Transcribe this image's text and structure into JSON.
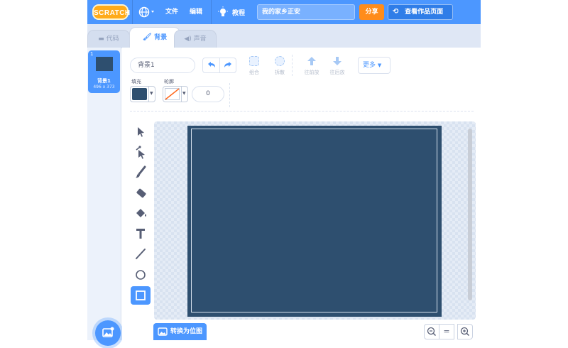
{
  "menubar": {
    "logo": "SCRATCH",
    "file": "文件",
    "edit": "编辑",
    "tutorials": "教程",
    "project_title": "我的家乡正安",
    "share": "分享",
    "see_project": "查看作品页面"
  },
  "tabs": [
    {
      "label": "代码",
      "icon": "code-icon"
    },
    {
      "label": "背景",
      "icon": "brush-icon",
      "active": true
    },
    {
      "label": "声音",
      "icon": "speaker-icon"
    }
  ],
  "backdrop_list": {
    "items": [
      {
        "index": "1",
        "name": "背景1",
        "size": "496 x 373",
        "selected": true
      }
    ]
  },
  "editor": {
    "costume_name": "背景1",
    "group_label": "组合",
    "ungroup_label": "拆散",
    "forward_label": "往前放",
    "backward_label": "往后放",
    "more_label": "更多",
    "fill_label": "填充",
    "outline_label": "轮廓",
    "stroke_width": "0",
    "convert_label": "转换为位图",
    "zoom_equal": "="
  },
  "colors": {
    "accent": "#4c97ff",
    "share": "#ff8c1a",
    "backdrop_fill": "#2e4f6f"
  }
}
